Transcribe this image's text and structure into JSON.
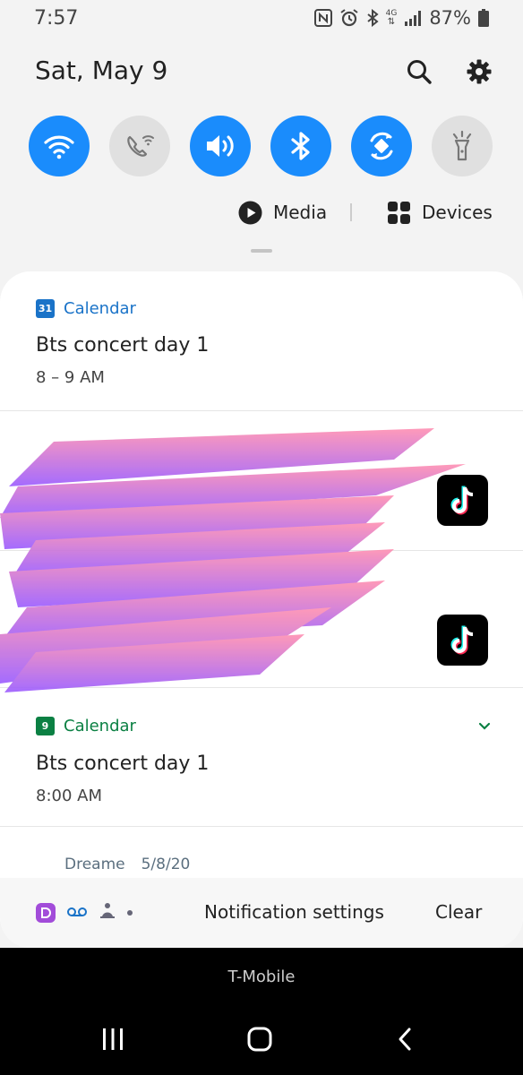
{
  "status_bar": {
    "time": "7:57",
    "network_label": "4G",
    "battery": "87%"
  },
  "header": {
    "date": "Sat, May 9",
    "search_icon": "search-icon",
    "settings_icon": "gear-icon"
  },
  "quick_settings": [
    {
      "name": "wifi",
      "icon": "wifi-icon",
      "state": "on"
    },
    {
      "name": "wifi-calling",
      "icon": "wifi-calling-icon",
      "state": "off"
    },
    {
      "name": "sound",
      "icon": "volume-icon",
      "state": "on"
    },
    {
      "name": "bluetooth",
      "icon": "bluetooth-icon",
      "state": "on"
    },
    {
      "name": "auto-rotate",
      "icon": "rotate-icon",
      "state": "on"
    },
    {
      "name": "flashlight",
      "icon": "flashlight-icon",
      "state": "off"
    }
  ],
  "media_row": {
    "media_label": "Media",
    "devices_label": "Devices"
  },
  "notifications": {
    "cal1": {
      "app": "Calendar",
      "icon_day": "31",
      "title": "Bts concert day 1",
      "time": "8 – 9 AM"
    },
    "cal2": {
      "app": "Calendar",
      "icon_day": "9",
      "title": "Bts concert day 1",
      "time": "8:00 AM"
    },
    "dreame": {
      "app": "Dreame",
      "date": "5/8/20"
    }
  },
  "bottom_bar": {
    "settings_label": "Notification settings",
    "clear_label": "Clear"
  },
  "carrier": "T-Mobile",
  "colors": {
    "accent": "#1a8cfc",
    "calendar_blue": "#1a73c8",
    "calendar_green": "#0b8043",
    "shade": "#f3f3f3"
  }
}
